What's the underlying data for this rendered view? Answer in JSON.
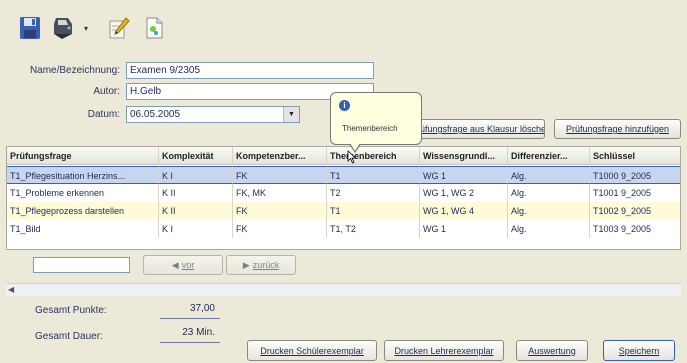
{
  "toolbar": {
    "icons": [
      "save-icon",
      "print-icon",
      "dropdown-arrow",
      "edit-icon",
      "new-document-icon"
    ]
  },
  "form": {
    "name_label": "Name/Bezeichnung:",
    "name_value": "Examen 9/2305",
    "author_label": "Autor:",
    "author_value": "H.Gelb",
    "date_label": "Datum:",
    "date_value": "06.05.2005"
  },
  "tooltip": {
    "icon": "info-icon",
    "text": "Themenbereich"
  },
  "actions": {
    "search_label": "Prüfungsfrage aus Klausur löschen",
    "add_label": "Prüfungsfrage hinzufügen"
  },
  "grid": {
    "columns": [
      "Prüfungsfrage",
      "Komplexität",
      "Kompetenzber...",
      "Themenbereich",
      "Wissensgrundl...",
      "Differenzier...",
      "Schlüssel"
    ],
    "rows": [
      [
        "T1_Pflegesituation Herzins...",
        "K I",
        "FK",
        "T1",
        "WG 1",
        "Alg.",
        "T1000 9_2005"
      ],
      [
        "T1_Probleme erkennen",
        "K II",
        "FK, MK",
        "T2",
        "WG 1, WG 2",
        "Alg.",
        "T1001 9_2005"
      ],
      [
        "T1_Pflegeprozess darstellen",
        "K II",
        "FK",
        "T1",
        "WG 1, WG 4",
        "Alg.",
        "T1002 9_2005"
      ],
      [
        "T1_Bild",
        "K I",
        "FK",
        "T1, T2",
        "WG 1",
        "Alg.",
        "T1003 9_2005"
      ]
    ]
  },
  "pager": {
    "page_value": "",
    "forward_label": "vor",
    "back_label": "zurück"
  },
  "summary": {
    "points_label": "Gesamt Punkte:",
    "points_value": "37,00",
    "duration_label": "Gesamt Dauer:",
    "duration_value": "23 Min."
  },
  "footer": {
    "print_student_label": "Drucken Schülerexemplar",
    "print_teacher_label": "Drucken Lehrerexemplar",
    "evaluation_label": "Auswertung",
    "save_label": "Speichern"
  }
}
